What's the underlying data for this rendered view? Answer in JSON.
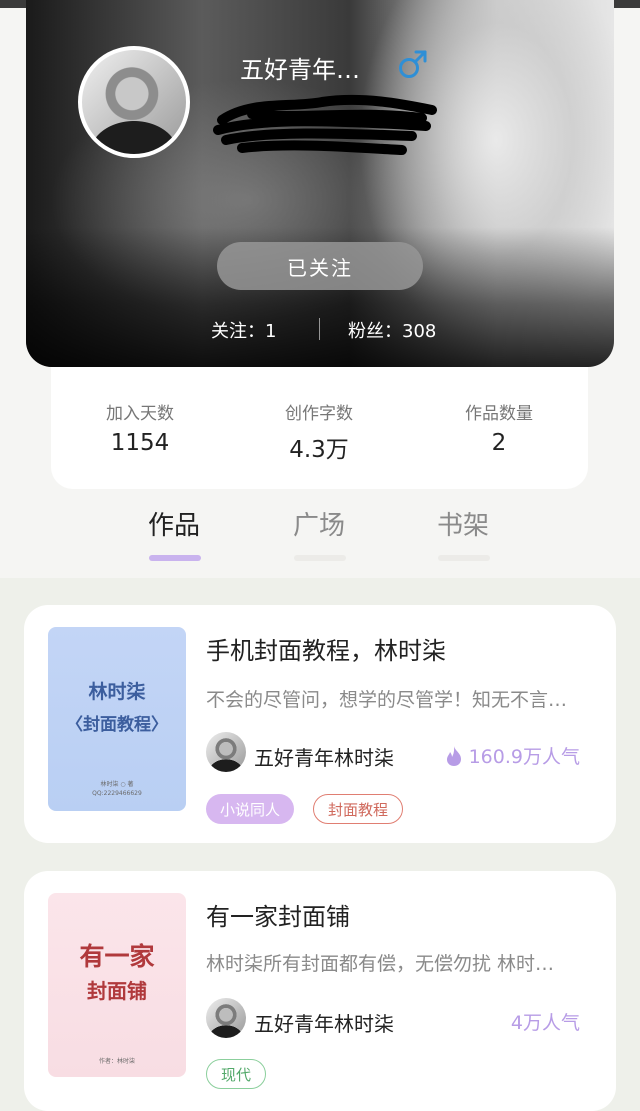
{
  "profile": {
    "username": "五好青年…",
    "gender_icon": "male-icon",
    "follow_button": "已关注",
    "following_label": "关注：1",
    "fans_label": "粉丝：308"
  },
  "info": {
    "join_days_label": "加入天数",
    "join_days_value": "1154",
    "words_label": "创作字数",
    "words_value": "4.3万",
    "works_label": "作品数量",
    "works_value": "2"
  },
  "tabs": [
    {
      "label": "作品",
      "active": true
    },
    {
      "label": "广场",
      "active": false
    },
    {
      "label": "书架",
      "active": false
    }
  ],
  "works": [
    {
      "title": "手机封面教程，林时柒",
      "description": "不会的尽管问，想学的尽管学！知无不言…",
      "author": "五好青年林时柒",
      "popularity": "160.9万人气",
      "tags": [
        "小说同人",
        "封面教程"
      ],
      "cover_line1": "林时柒",
      "cover_line2": "〈封面教程〉",
      "cover_small1": "林时柒 ○ 著",
      "cover_small2": "QQ:2229466629"
    },
    {
      "title": "有一家封面铺",
      "description": "林时柒所有封面都有偿，无偿勿扰 林时…",
      "author": "五好青年林时柒",
      "popularity": "4万人气",
      "tags": [
        "现代"
      ],
      "cover_line1": "有一家",
      "cover_line2": "封面铺",
      "cover_small1": "作者：林时柒"
    }
  ],
  "colors": {
    "accent_purple": "#c9b3ee",
    "popularity": "#b79ce6",
    "tag_purple": "#d7b7f0",
    "tag_red": "#e07e72",
    "tag_green": "#8bcf9c"
  }
}
